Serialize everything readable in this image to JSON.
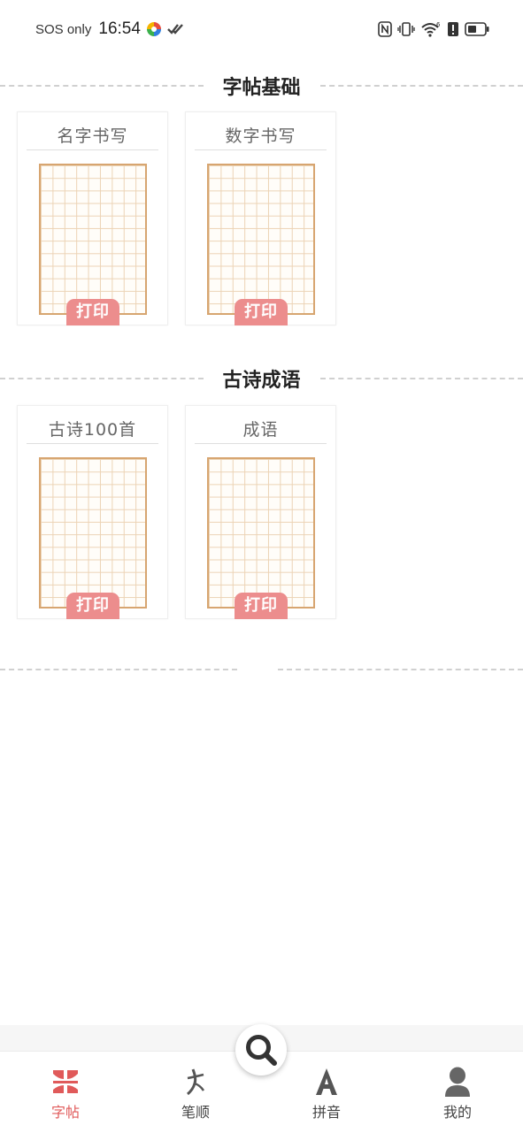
{
  "status_bar": {
    "carrier": "SOS only",
    "time": "16:54",
    "icons": [
      "nfc-icon",
      "vibrate-icon",
      "wifi-6-icon",
      "battery-alert-icon",
      "battery-icon"
    ]
  },
  "sections": [
    {
      "title": "字帖基础",
      "cards": [
        {
          "title": "名字书写",
          "button": "打印"
        },
        {
          "title": "数字书写",
          "button": "打印"
        }
      ]
    },
    {
      "title": "古诗成语",
      "cards": [
        {
          "title": "古诗100首",
          "button": "打印"
        },
        {
          "title": "成语",
          "button": "打印"
        }
      ]
    }
  ],
  "tab_bar": {
    "tabs": [
      {
        "label": "字帖",
        "icon": "copybook-icon",
        "active": true
      },
      {
        "label": "笔顺",
        "icon": "stroke-order-icon",
        "active": false
      },
      {
        "label": "拼音",
        "icon": "pinyin-a-icon",
        "active": false
      },
      {
        "label": "我的",
        "icon": "profile-icon",
        "active": false
      }
    ],
    "center_button_icon": "search-icon"
  },
  "colors": {
    "accent": "#e05a5a",
    "print_button": "#ec8d8d",
    "grid_border": "#d7a570",
    "grid_line": "#ecd3b5"
  }
}
